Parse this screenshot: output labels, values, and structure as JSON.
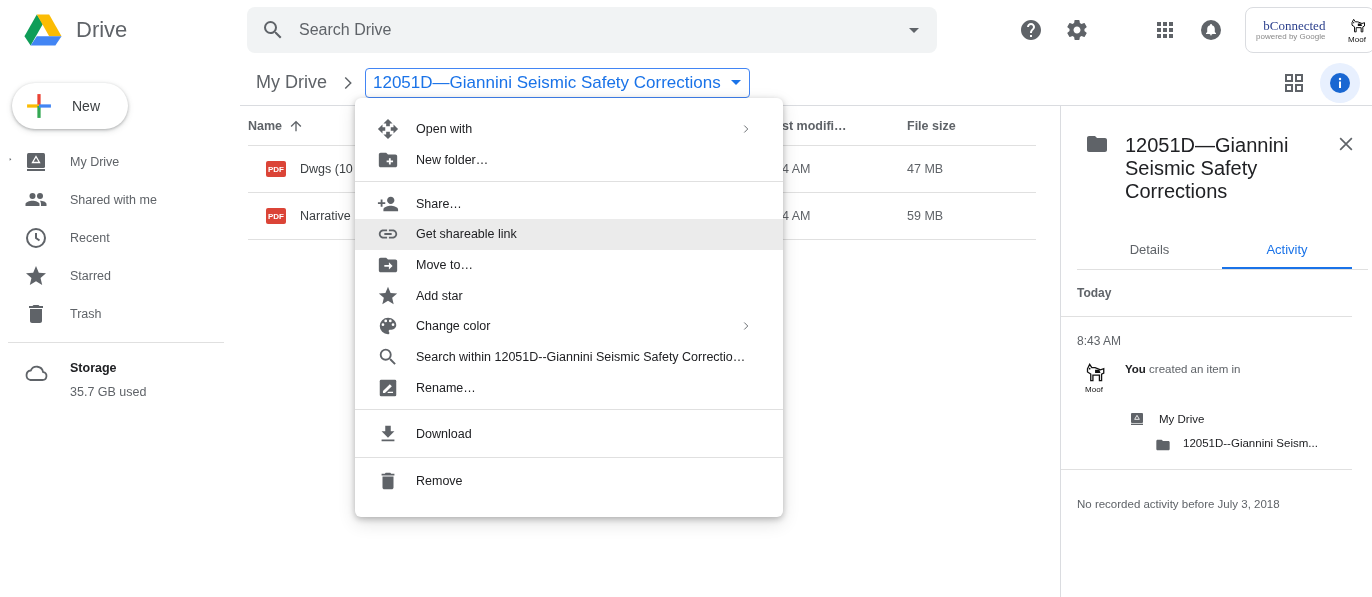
{
  "header": {
    "app_name": "Drive",
    "search": {
      "placeholder": "Search Drive"
    },
    "account": {
      "brand": "bConnected",
      "tagline": "powered by Google",
      "avatar_caption": "Moof"
    }
  },
  "sidebar": {
    "new_button": "New",
    "items": [
      {
        "label": "My Drive",
        "expanded": false,
        "selected": false
      },
      {
        "label": "Shared with me",
        "selected": false
      },
      {
        "label": "Recent",
        "selected": false
      },
      {
        "label": "Starred",
        "selected": false
      },
      {
        "label": "Trash",
        "selected": false
      }
    ],
    "storage": {
      "label": "Storage",
      "usage": "35.7 GB used"
    }
  },
  "breadcrumb": {
    "root": "My Drive",
    "current": "12051D—Giannini Seismic Safety Corrections"
  },
  "view": {
    "details_open": true
  },
  "table": {
    "columns": [
      {
        "label": "Name",
        "sorted": true
      },
      {
        "label": "st modifi…"
      },
      {
        "label": "File size"
      }
    ],
    "rows": [
      {
        "type_label": "PDF",
        "name": "Dwgs (10",
        "modified": "4 AM",
        "size": "47 MB"
      },
      {
        "type_label": "PDF",
        "name": "Narrative",
        "modified": "4 AM",
        "size": "59 MB"
      }
    ]
  },
  "context_menu": {
    "sections": [
      [
        {
          "label": "Open with",
          "submenu": true,
          "selected": false
        },
        {
          "label": "New folder…",
          "submenu": false,
          "selected": false
        }
      ],
      [
        {
          "label": "Share…",
          "submenu": false,
          "selected": false
        },
        {
          "label": "Get shareable link",
          "submenu": false,
          "selected": true
        },
        {
          "label": "Move to…",
          "submenu": false,
          "selected": false
        },
        {
          "label": "Add star",
          "submenu": false,
          "selected": false
        },
        {
          "label": "Change color",
          "submenu": true,
          "selected": false
        },
        {
          "label": "Search within 12051D--Giannini Seismic Safety Correctio…",
          "submenu": false,
          "selected": false
        },
        {
          "label": "Rename…",
          "submenu": false,
          "selected": false
        }
      ],
      [
        {
          "label": "Download",
          "submenu": false,
          "selected": false
        }
      ],
      [
        {
          "label": "Remove",
          "submenu": false,
          "selected": false
        }
      ]
    ]
  },
  "details": {
    "title": "12051D—Giannini Seismic Safety Corrections",
    "tabs": [
      {
        "label": "Details",
        "selected": false
      },
      {
        "label": "Activity",
        "selected": true
      }
    ],
    "activity": {
      "day": "Today",
      "time": "8:43 AM",
      "avatar_caption": "Moof",
      "actor": "You",
      "action": " created an item in",
      "location": "My Drive",
      "item": "12051D--Giannini Seism...",
      "footer": "No recorded activity before July 3, 2018"
    }
  }
}
